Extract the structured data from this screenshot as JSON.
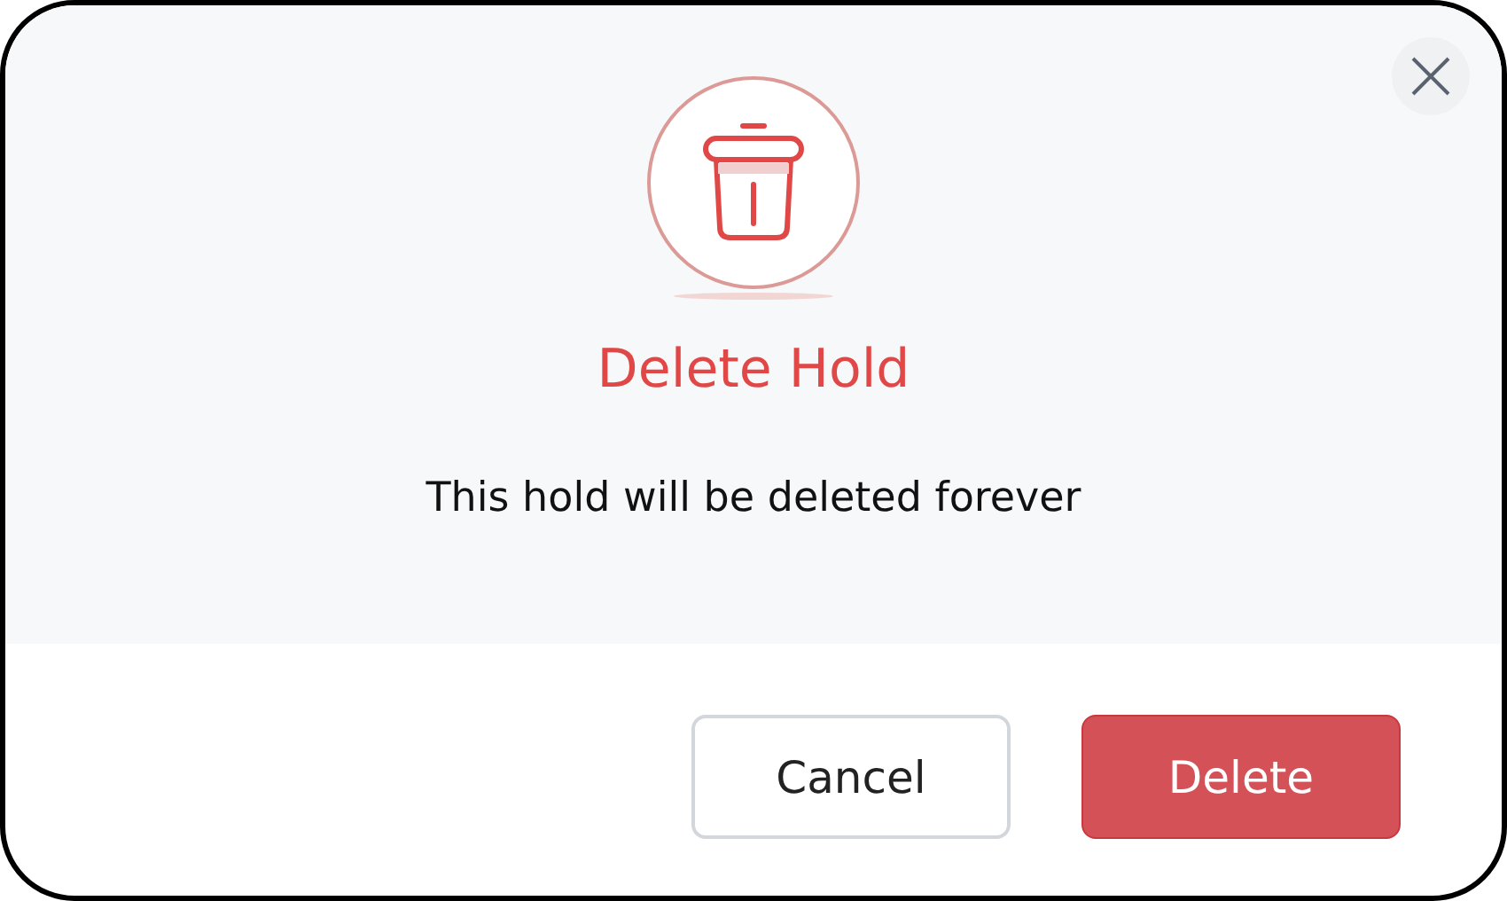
{
  "dialog": {
    "title": "Delete Hold",
    "message": "This hold will be deleted forever",
    "buttons": [
      {
        "label": "Cancel",
        "kind": "secondary"
      },
      {
        "label": "Delete",
        "kind": "danger"
      }
    ]
  }
}
